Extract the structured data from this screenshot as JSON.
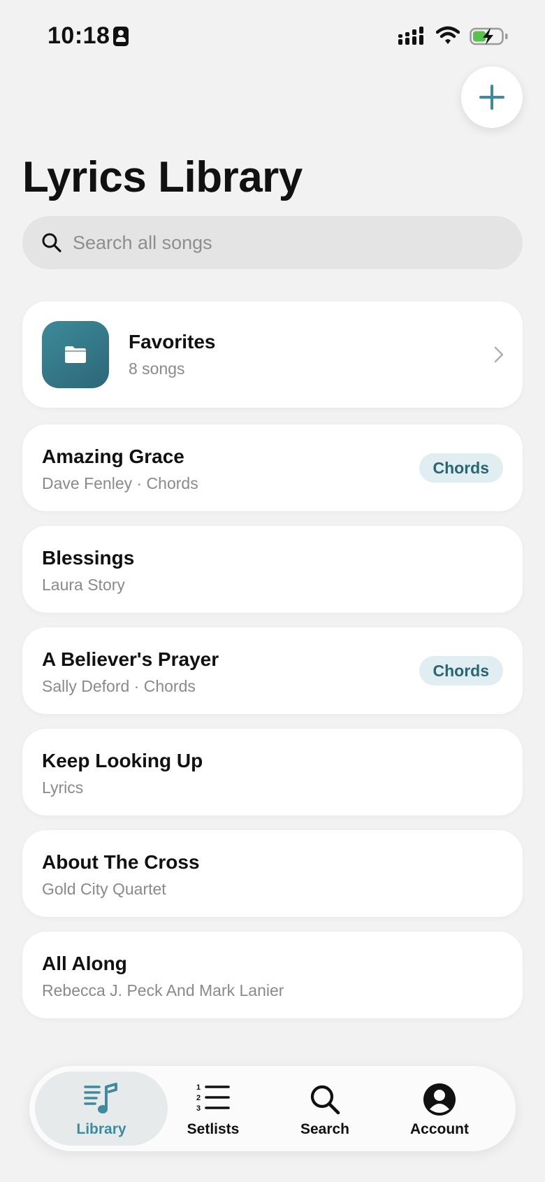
{
  "status_bar": {
    "time": "10:18"
  },
  "header": {
    "title": "Lyrics Library"
  },
  "search": {
    "placeholder": "Search all songs",
    "value": ""
  },
  "folder": {
    "title": "Favorites",
    "count": "8 songs"
  },
  "songs": [
    {
      "title": "Amazing Grace",
      "subtitle": "Dave Fenley · Chords",
      "badge": "Chords"
    },
    {
      "title": "Blessings",
      "subtitle": "Laura Story",
      "badge": ""
    },
    {
      "title": "A Believer's Prayer",
      "subtitle": "Sally Deford · Chords",
      "badge": "Chords"
    },
    {
      "title": "Keep Looking Up",
      "subtitle": "Lyrics",
      "badge": ""
    },
    {
      "title": "About The Cross",
      "subtitle": "Gold City Quartet",
      "badge": ""
    },
    {
      "title": "All Along",
      "subtitle": "Rebecca J. Peck And Mark Lanier",
      "badge": ""
    }
  ],
  "tabs": [
    {
      "label": "Library",
      "icon": "music-list-icon",
      "active": true
    },
    {
      "label": "Setlists",
      "icon": "numbered-list-icon",
      "active": false
    },
    {
      "label": "Search",
      "icon": "search-icon",
      "active": false
    },
    {
      "label": "Account",
      "icon": "account-icon",
      "active": false
    }
  ],
  "colors": {
    "accent": "#3f8a9c",
    "folder_tile": "#2f6e7e",
    "badge_bg": "#e0eef1",
    "background": "#f2f2f2"
  }
}
